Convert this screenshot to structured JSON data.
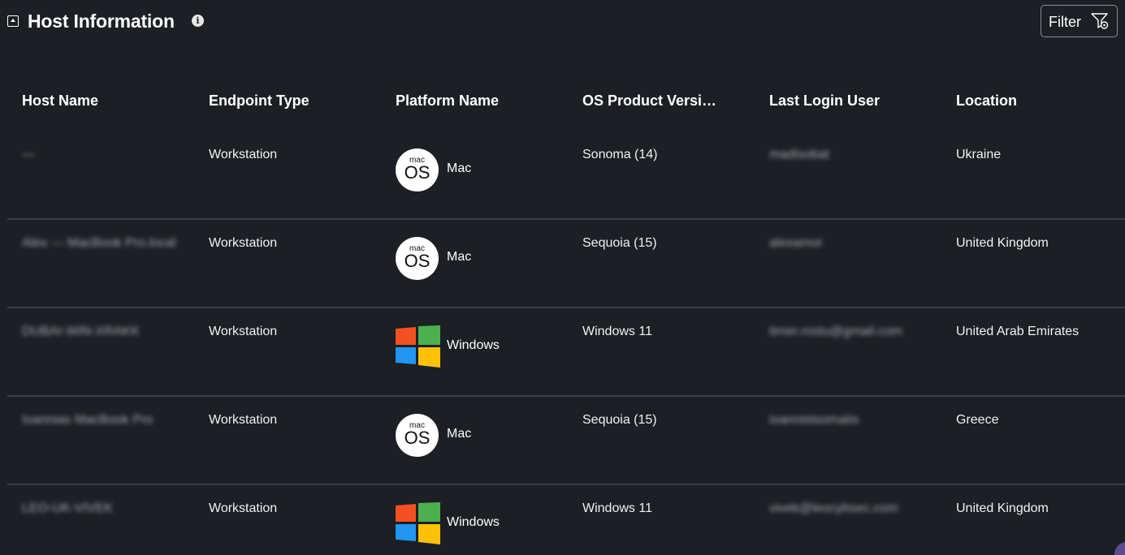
{
  "header": {
    "title": "Host Information",
    "info_icon": "info-icon",
    "collapse_icon": "collapse-up-icon",
    "filter_label": "Filter",
    "filter_icon": "filter-settings-icon"
  },
  "table": {
    "columns": [
      "Host Name",
      "Endpoint Type",
      "Platform Name",
      "OS Product Versi…",
      "Last Login User",
      "Location"
    ],
    "rows": [
      {
        "host": "—",
        "endpoint": "Workstation",
        "platform": "Mac",
        "platform_icon": "macos-icon",
        "os": "Sonoma (14)",
        "user": "madisobat",
        "location": "Ukraine"
      },
      {
        "host": "Alex — MacBook Pro.local",
        "endpoint": "Workstation",
        "platform": "Mac",
        "platform_icon": "macos-icon",
        "os": "Sequoia (15)",
        "user": "alexamor",
        "location": "United Kingdom"
      },
      {
        "host": "DUBAI-WIN-XRAKK",
        "endpoint": "Workstation",
        "platform": "Windows",
        "platform_icon": "windows-icon",
        "os": "Windows 11",
        "user": "timer.rostu@gmail.com",
        "location": "United Arab Emirates"
      },
      {
        "host": "Ioannias MacBook Pro",
        "endpoint": "Workstation",
        "platform": "Mac",
        "platform_icon": "macos-icon",
        "os": "Sequoia (15)",
        "user": "ioannistsomatis",
        "location": "Greece"
      },
      {
        "host": "LEO-UK-VIVEK",
        "endpoint": "Workstation",
        "platform": "Windows",
        "platform_icon": "windows-icon",
        "os": "Windows 11",
        "user": "vivek@leocybsec.com",
        "location": "United Kingdom"
      }
    ]
  },
  "colors": {
    "background": "#1c1f23",
    "divider": "#3b3f45",
    "win_red": "#f25022",
    "win_green": "#4caf50",
    "win_blue": "#2196f3",
    "win_yellow": "#ffc107"
  }
}
